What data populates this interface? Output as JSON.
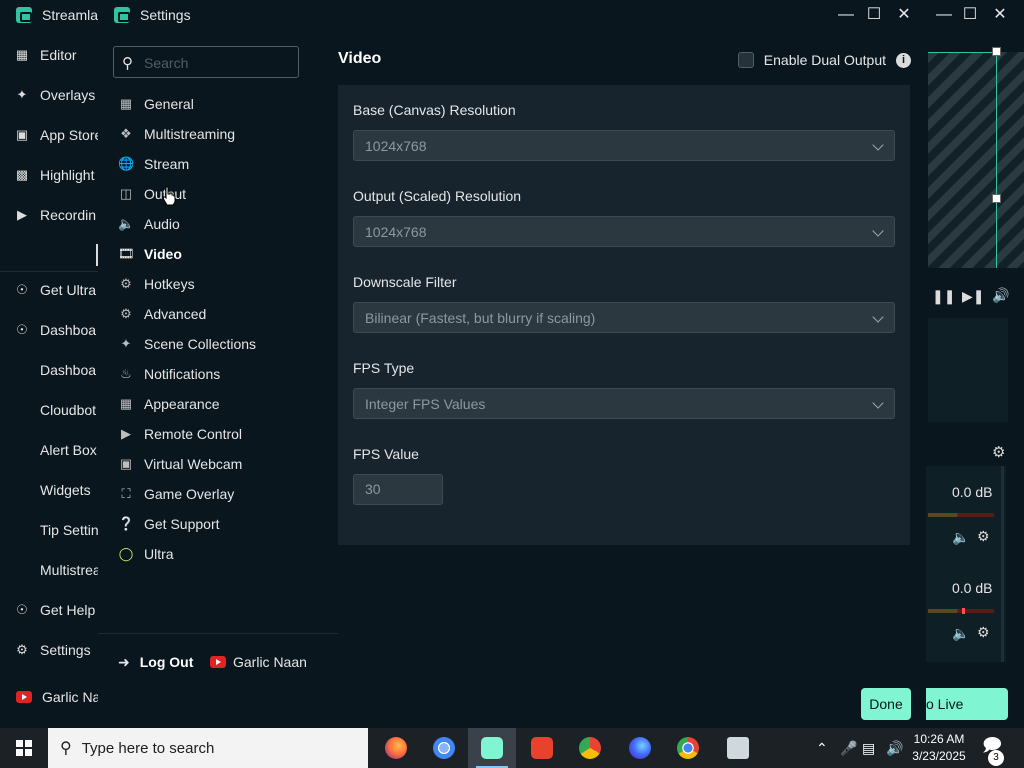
{
  "main_window": {
    "title": "Streamla",
    "nav": [
      {
        "label": "Editor",
        "icon": "editor-icon"
      },
      {
        "label": "Overlays",
        "icon": "overlays-icon"
      },
      {
        "label": "App Store",
        "icon": "app-store-icon"
      },
      {
        "label": "Highlight",
        "icon": "highlight-icon"
      },
      {
        "label": "Recordin",
        "icon": "recordings-icon"
      },
      {
        "label": "Get Ultra",
        "icon": "ultra-icon"
      },
      {
        "label": "Dashboa",
        "icon": "dashboard-icon"
      },
      {
        "label": "Dashboa",
        "icon": ""
      },
      {
        "label": "Cloudbot",
        "icon": ""
      },
      {
        "label": "Alert Box",
        "icon": ""
      },
      {
        "label": "Widgets",
        "icon": ""
      },
      {
        "label": "Tip Settin",
        "icon": ""
      },
      {
        "label": "Multistrea",
        "icon": ""
      },
      {
        "label": "Get Help",
        "icon": "help-icon"
      },
      {
        "label": "Settings",
        "icon": "gear-icon"
      },
      {
        "label": "Garlic Na",
        "icon": "youtube-icon"
      }
    ],
    "mixer": {
      "levels": [
        "0.0 dB",
        "0.0 dB"
      ]
    },
    "go_live_label": "o Live"
  },
  "settings": {
    "title": "Settings",
    "search": {
      "placeholder": "Search"
    },
    "menu": [
      {
        "label": "General",
        "icon": "general-icon"
      },
      {
        "label": "Multistreaming",
        "icon": "multistreaming-icon"
      },
      {
        "label": "Stream",
        "icon": "globe-icon"
      },
      {
        "label": "Output",
        "icon": "output-icon"
      },
      {
        "label": "Audio",
        "icon": "speaker-icon"
      },
      {
        "label": "Video",
        "icon": "film-icon"
      },
      {
        "label": "Hotkeys",
        "icon": "hotkeys-gear-icon"
      },
      {
        "label": "Advanced",
        "icon": "advanced-gears-icon"
      },
      {
        "label": "Scene Collections",
        "icon": "scene-collections-icon"
      },
      {
        "label": "Notifications",
        "icon": "bell-icon"
      },
      {
        "label": "Appearance",
        "icon": "appearance-icon"
      },
      {
        "label": "Remote Control",
        "icon": "remote-play-icon"
      },
      {
        "label": "Virtual Webcam",
        "icon": "camera-icon"
      },
      {
        "label": "Game Overlay",
        "icon": "game-overlay-icon"
      },
      {
        "label": "Get Support",
        "icon": "question-icon"
      },
      {
        "label": "Ultra",
        "icon": "ultra-ring-icon"
      }
    ],
    "active_section": "Video",
    "logout_label": "Log Out",
    "account_name": "Garlic Naan",
    "section_title": "Video",
    "dual_output_label": "Enable Dual Output",
    "dual_output_checked": false,
    "fields": {
      "base_resolution": {
        "label": "Base (Canvas) Resolution",
        "value": "1024x768"
      },
      "output_resolution": {
        "label": "Output (Scaled) Resolution",
        "value": "1024x768"
      },
      "downscale_filter": {
        "label": "Downscale Filter",
        "value": "Bilinear (Fastest, but blurry if scaling)"
      },
      "fps_type": {
        "label": "FPS Type",
        "value": "Integer FPS Values"
      },
      "fps_value": {
        "label": "FPS Value",
        "value": "30"
      }
    },
    "done_label": "Done"
  },
  "taskbar": {
    "search_placeholder": "Type here to search",
    "apps": [
      "firefox-icon",
      "chromium-icon",
      "streamlabs-icon",
      "app-red-icon",
      "chrome-b-icon",
      "firefox-dev-icon",
      "chrome-icon",
      "rdp-icon"
    ],
    "time": "10:26 AM",
    "date": "3/23/2025",
    "notification_count": "3"
  },
  "colors": {
    "background": "#09161d",
    "panel": "#17242d",
    "input": "#2b383f",
    "accent": "#80f5d2",
    "teal": "#31c3a2"
  }
}
